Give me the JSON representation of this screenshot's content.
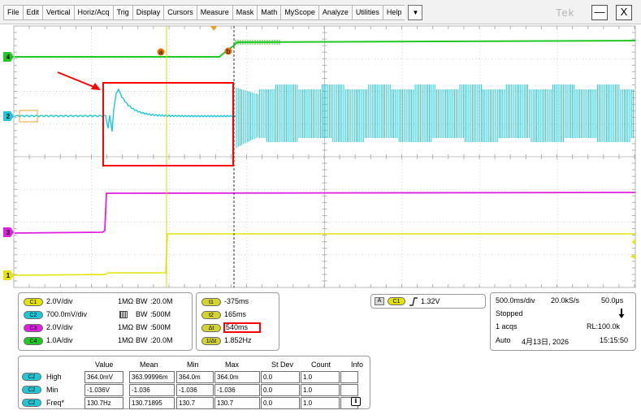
{
  "menu": [
    "File",
    "Edit",
    "Vertical",
    "Horiz/Acq",
    "Trig",
    "Display",
    "Cursors",
    "Measure",
    "Mask",
    "Math",
    "MyScope",
    "Analyze",
    "Utilities",
    "Help"
  ],
  "menu_dropdown_icon": "chevron-down-icon",
  "brand": "Tek",
  "window_buttons": {
    "minimize": "—",
    "close": "X"
  },
  "colors": {
    "ch1": "#e4e400",
    "ch2": "#1ec8d8",
    "ch3": "#e020e0",
    "ch4": "#22c822",
    "cursor_b": "#d8d800",
    "annotation": "#ff0000"
  },
  "scope": {
    "channel_markers": [
      {
        "num": "4",
        "color": "#22c822"
      },
      {
        "num": "2",
        "color": "#1ec8d8"
      },
      {
        "num": "3",
        "color": "#e020e0"
      },
      {
        "num": "1",
        "color": "#e4e400"
      }
    ],
    "cursor_labels": [
      "a",
      "b"
    ]
  },
  "channels": [
    {
      "pill": "C1",
      "color": "#e4e400",
      "scale": "2.0V/div",
      "imp": "1MΩ",
      "bw": "20.0M"
    },
    {
      "pill": "C2",
      "color": "#1ec8d8",
      "scale": "700.0mV/div",
      "imp": "",
      "bw": "500M"
    },
    {
      "pill": "C3",
      "color": "#e020e0",
      "scale": "2.0V/div",
      "imp": "1MΩ",
      "bw": "500M"
    },
    {
      "pill": "C4",
      "color": "#22c822",
      "scale": "1.0A/div",
      "imp": "1MΩ",
      "bw": "20.0M"
    }
  ],
  "bw_prefix": "BW:",
  "cursors": [
    {
      "label": "t1",
      "value": "-375ms"
    },
    {
      "label": "t2",
      "value": "165ms"
    },
    {
      "label": "Δt",
      "value": "540ms"
    },
    {
      "label": "1/Δt",
      "value": "1.852Hz"
    }
  ],
  "trigger": {
    "source_tag": "A",
    "channel": "C1",
    "slope_icon": "rising-edge-icon",
    "level": "1.32V"
  },
  "acquisition": {
    "time_div": "500.0ms/div",
    "sample_rate": "20.0kS/s",
    "resolution": "50.0μs",
    "state": "Stopped",
    "acqs": "1 acqs",
    "record_length": "RL:100.0k",
    "mode": "Auto",
    "date": "4月13日, 2026",
    "time": "15:15:50"
  },
  "measurements": {
    "headers": [
      "Value",
      "Mean",
      "Min",
      "Max",
      "St Dev",
      "Count",
      "Info"
    ],
    "rows": [
      {
        "channel": "C2",
        "name": "High",
        "cells": [
          "364.0mV",
          "363.99996m",
          "364.0m",
          "364.0m",
          "0.0",
          "1.0",
          ""
        ]
      },
      {
        "channel": "C2",
        "name": "Min",
        "cells": [
          "-1.036V",
          "-1.036",
          "-1.036",
          "-1.036",
          "0.0",
          "1.0",
          ""
        ]
      },
      {
        "channel": "C2",
        "name": "Freq*",
        "cells": [
          "130.7Hz",
          "130.71895",
          "130.7",
          "130.7",
          "0.0",
          "1.0",
          ""
        ]
      }
    ],
    "info_icon": "info-icon"
  }
}
